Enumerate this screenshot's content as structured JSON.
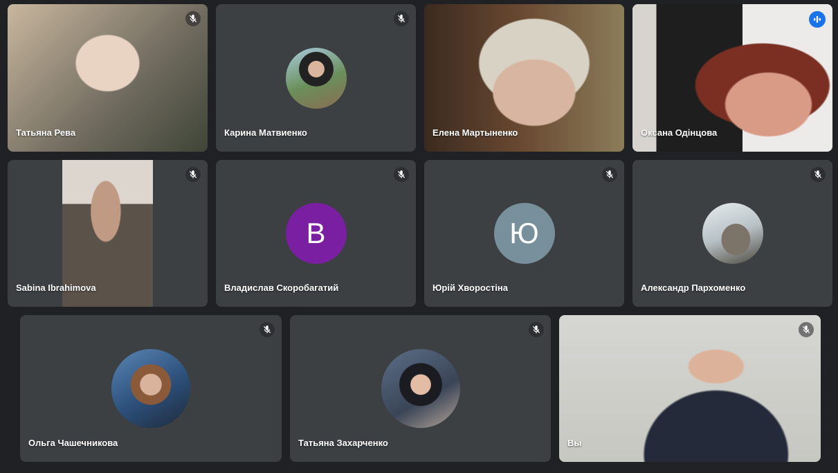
{
  "participants": [
    {
      "name": "Татьяна Рева",
      "muted": true,
      "type": "video"
    },
    {
      "name": "Карина Матвиенко",
      "muted": true,
      "type": "photo-avatar"
    },
    {
      "name": "Елена Мартыненко",
      "muted": false,
      "type": "video"
    },
    {
      "name": "Оксана Одінцова",
      "muted": false,
      "type": "video",
      "speaking": true
    },
    {
      "name": "Sabina Ibrahimova",
      "muted": true,
      "type": "video"
    },
    {
      "name": "Владислав Скоробагатий",
      "muted": true,
      "type": "letter-avatar",
      "initial": "В",
      "color": "#7b1fa2"
    },
    {
      "name": "Юрій Хворостіна",
      "muted": true,
      "type": "letter-avatar",
      "initial": "Ю",
      "color": "#78909c"
    },
    {
      "name": "Александр Пархоменко",
      "muted": true,
      "type": "photo-avatar"
    },
    {
      "name": "Ольга Чашечникова",
      "muted": true,
      "type": "photo-avatar"
    },
    {
      "name": "Татьяна Захарченко",
      "muted": true,
      "type": "photo-avatar"
    },
    {
      "name": "Вы",
      "muted": true,
      "type": "video",
      "self": true
    }
  ],
  "colors": {
    "background": "#202124",
    "tile": "#3c4043",
    "accent": "#1a73e8",
    "active_outline": "#8ab4f8"
  },
  "icons": {
    "muted": "mic-off-icon",
    "speaking": "audio-level-icon"
  }
}
